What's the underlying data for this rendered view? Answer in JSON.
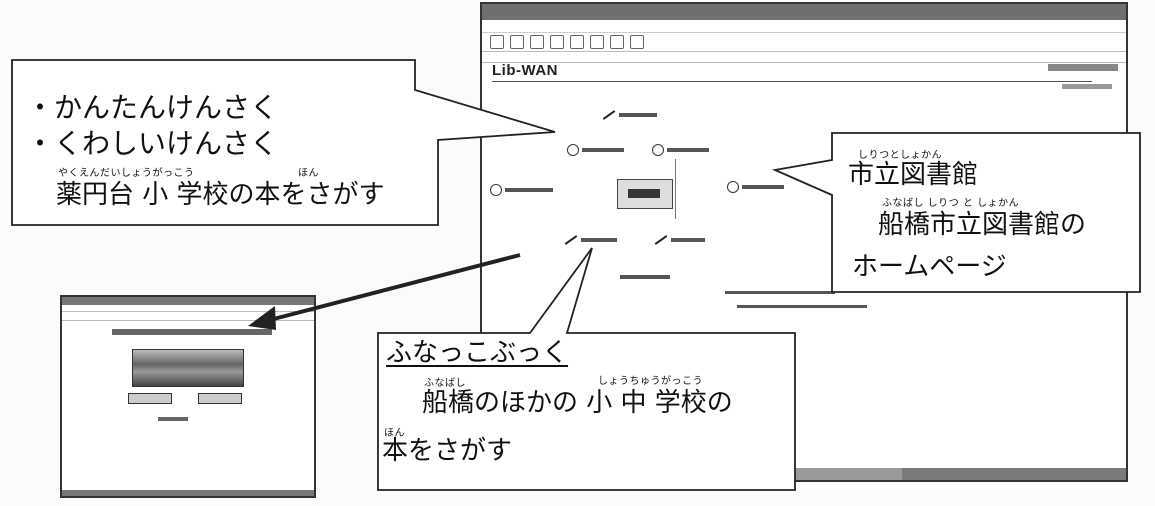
{
  "left_callout": {
    "line1": "・かんたんけんさく",
    "line2": "・くわしいけんさく",
    "ruby1": "やくえんだいしょうがっこう",
    "ruby2": "ほん",
    "line3": "薬円台 小 学校の本をさがす"
  },
  "right_callout": {
    "ruby1": "しりつとしょかん",
    "line1": "市立図書館",
    "ruby2": "ふなばし しりつ と しょかん",
    "line2": "船橋市立図書館の",
    "line3": "ホームページ"
  },
  "bottom_callout": {
    "title": "ふなっこぶっく",
    "ruby1": "ふなばし",
    "ruby2": "しょうちゅうがっこう",
    "line1": "船橋のほかの 小 中 学校の",
    "ruby3": "ほん",
    "line2": "本をさがす"
  },
  "main_screenshot": {
    "logo": "Lib-WAN"
  }
}
